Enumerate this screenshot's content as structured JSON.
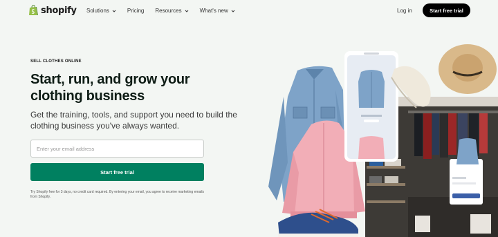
{
  "nav": {
    "brand": "shopify",
    "menu": [
      {
        "label": "Solutions",
        "has_dropdown": true
      },
      {
        "label": "Pricing",
        "has_dropdown": false
      },
      {
        "label": "Resources",
        "has_dropdown": true
      },
      {
        "label": "What's new",
        "has_dropdown": true
      }
    ],
    "login": "Log in",
    "cta": "Start free trial"
  },
  "hero": {
    "eyebrow": "SELL CLOTHES ONLINE",
    "headline": "Start, run, and grow your clothing business",
    "subtext": "Get the training, tools, and support you need to build the clothing business you've always wanted.",
    "email_placeholder": "Enter your email address",
    "cta": "Start free trial",
    "disclaimer": "Try Shopify free for 3 days, no credit card required. By entering your email, you agree to receive marketing emails from Shopify."
  },
  "colors": {
    "background": "#f3f6f3",
    "brand_green": "#008060",
    "nav_cta": "#000000",
    "logo_green": "#95bf47"
  }
}
